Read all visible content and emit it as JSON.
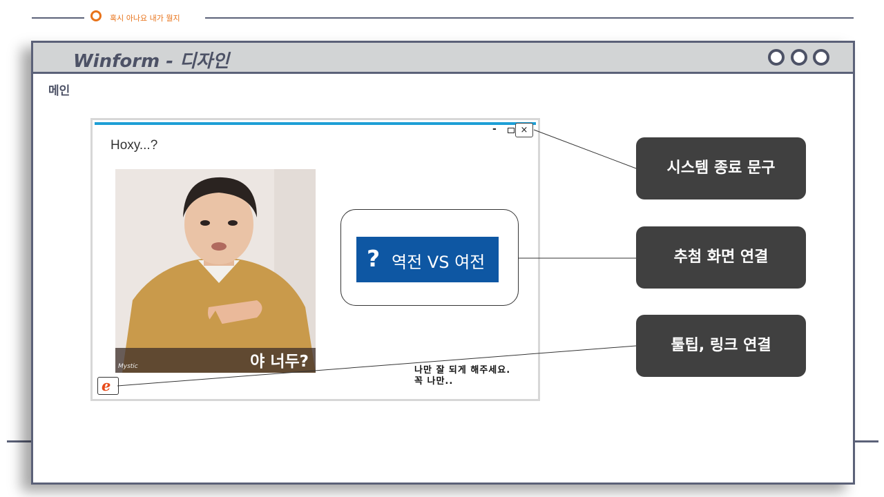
{
  "header": {
    "caption": "혹시 아나요 내가 뭘지"
  },
  "slide": {
    "title": "Winform - 디자인",
    "subtitle": "메인",
    "window_buttons": [
      "circle",
      "circle",
      "circle"
    ]
  },
  "form": {
    "title": "Hoxy...?",
    "controls": {
      "minimize": "-",
      "close": "×"
    },
    "photo": {
      "caption": "야 너두?",
      "watermark": "Mystic"
    },
    "main_button": {
      "icon": "?",
      "label": "역전 VS 여전"
    },
    "link_icon": "e",
    "bottom_note": [
      "나만 잘 되게 해주세요.",
      "꼭 나만.."
    ]
  },
  "callouts": [
    {
      "label": "시스템 종료 문구"
    },
    {
      "label": "추첨 화면 연결"
    },
    {
      "label": "툴팁, 링크 연결"
    }
  ],
  "colors": {
    "accent_orange": "#e8731a",
    "frame": "#5b6178",
    "titlebar": "#d2d4d5",
    "form_accent": "#1e9fd6",
    "button_blue": "#0e57a3",
    "callout": "#404040"
  }
}
